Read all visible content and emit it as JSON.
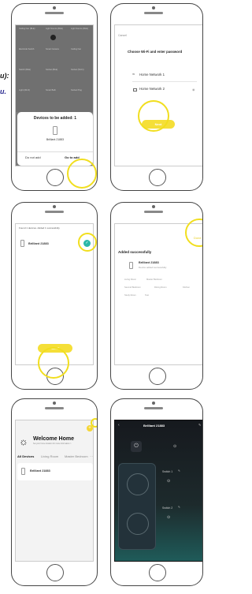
{
  "sidebar": {
    "label_a": "u):",
    "label_b": "u."
  },
  "phone1": {
    "grid": [
      {
        "label": "Ceiling Fan (BLE)"
      },
      {
        "label": "Light Source (BLE)"
      },
      {
        "label": "Light Source (BLE)"
      },
      {
        "label": "Electrode Switch"
      },
      {
        "label": "Smart Camera"
      },
      {
        "label": "Ceiling Fan"
      },
      {
        "label": "Switch (BLE)"
      },
      {
        "label": "Socket (BLE)"
      },
      {
        "label": "Socket (Wi-Fi)"
      },
      {
        "label": "Light (Wi-Fi)"
      },
      {
        "label": "Smart Bulb"
      },
      {
        "label": "Socket Plug"
      }
    ],
    "modal_title": "Devices to be added: 1",
    "device_name": "Brilliant 21883",
    "do_not_add": "Do not add",
    "go_to_add": "Go to add"
  },
  "phone2": {
    "cancel": "Cancel",
    "title": "Choose Wi-Fi and enter password",
    "network1": "Home Network 1",
    "network2": "Home Network 2",
    "next": "Next"
  },
  "phone3": {
    "found_text": "Found 1 devices. Added 1 successfully.",
    "device_name": "Brilliant 21883",
    "next": "NEXT"
  },
  "phone4": {
    "done": "Done",
    "title": "Added successfully",
    "device_name": "Brilliant 21883",
    "device_sub": "Device added successfully",
    "rooms": [
      "Living Room",
      "Master Bedroom",
      "Second Bedroom",
      "Dining Room",
      "Kitchen",
      "Study Room",
      "Test"
    ]
  },
  "phone5": {
    "welcome": "Welcome Home",
    "subtitle": "Set your home location for more information >",
    "tabs": [
      "All Devices",
      "Living Room",
      "Master Bedroom",
      "···"
    ],
    "device_name": "Brilliant 21883"
  },
  "phone6": {
    "title": "Brilliant 21883",
    "switch1": "Switch 1",
    "switch2": "Switch 2"
  }
}
